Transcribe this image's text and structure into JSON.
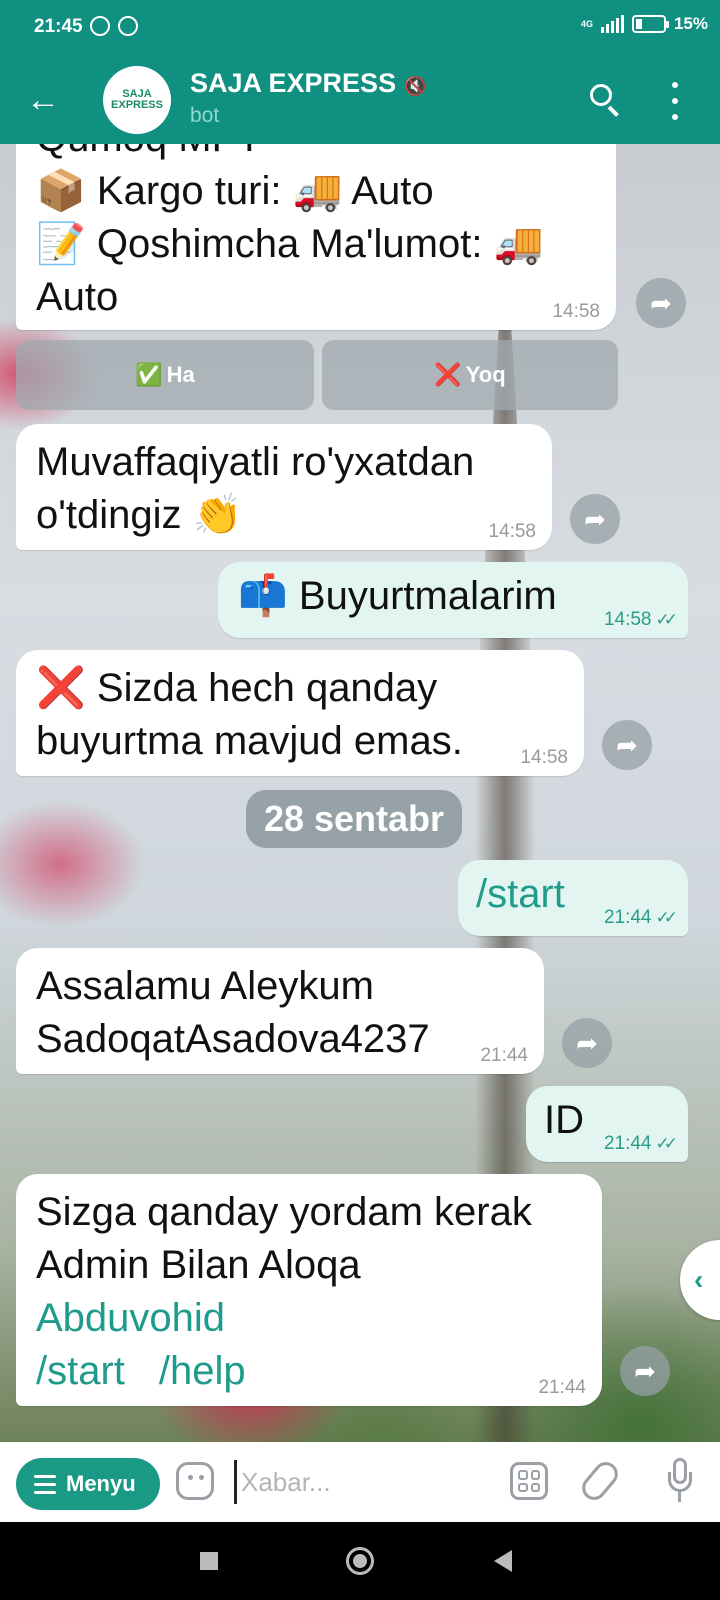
{
  "status_bar": {
    "time": "21:45",
    "network": "4G",
    "battery": "15%"
  },
  "header": {
    "title": "SAJA EXPRESS",
    "subtitle": "bot",
    "avatar_text": "SAJA EXPRESS"
  },
  "messages": [
    {
      "lines": [
        "Qumoq MFY",
        "📦 Kargo turi: 🚚 Auto",
        "📝 Qoshimcha Ma'lumot: 🚚",
        "Auto"
      ],
      "time": "14:58"
    },
    {
      "text": "Muvaffaqiyatli ro'yxatdan o'tdingiz 👏",
      "time": "14:58"
    },
    {
      "text": "📫 Buyurtmalarim",
      "time": "14:58"
    },
    {
      "text": "❌ Sizda hech qanday buyurtma mavjud emas.",
      "time": "14:58"
    },
    {
      "text": "/start",
      "time": "21:44"
    },
    {
      "text": "Assalamu Aleykum SadoqatAsadova4237",
      "time": "21:44"
    },
    {
      "text": "ID",
      "time": "21:44"
    },
    {
      "line1": "Sizga qanday yordam kerak",
      "line2": "Admin Bilan Aloqa",
      "link1": "Abduvohid",
      "link2": "/start",
      "link3": "/help",
      "time": "21:44"
    }
  ],
  "inline_buttons": {
    "yes": "Ha",
    "yes_icon": "✅",
    "no": "Yoq",
    "no_icon": "❌"
  },
  "date_separator": "28 sentabr",
  "input": {
    "menu_label": "Menyu",
    "placeholder": "Xabar..."
  },
  "ticks": "✓✓",
  "colors": {
    "header": "#0f9080",
    "accent": "#1a9a84",
    "link": "#1f9b8c",
    "out_bubble": "#e3f5f0"
  }
}
